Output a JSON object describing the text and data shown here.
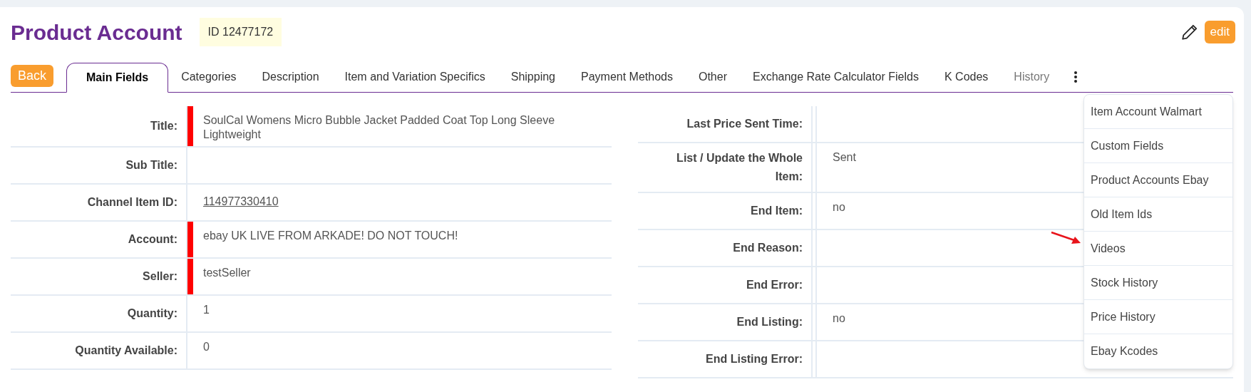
{
  "header": {
    "title": "Product Account",
    "id_badge": "ID 12477172",
    "edit_button": "edit"
  },
  "back_button": "Back",
  "tabs": [
    {
      "label": "Main Fields",
      "selected": true,
      "disabled": false
    },
    {
      "label": "Categories",
      "selected": false,
      "disabled": false
    },
    {
      "label": "Description",
      "selected": false,
      "disabled": false
    },
    {
      "label": "Item and Variation Specifics",
      "selected": false,
      "disabled": false
    },
    {
      "label": "Shipping",
      "selected": false,
      "disabled": false
    },
    {
      "label": "Payment Methods",
      "selected": false,
      "disabled": false
    },
    {
      "label": "Other",
      "selected": false,
      "disabled": false
    },
    {
      "label": "Exchange Rate Calculator Fields",
      "selected": false,
      "disabled": false
    },
    {
      "label": "K Codes",
      "selected": false,
      "disabled": false
    },
    {
      "label": "History",
      "selected": false,
      "disabled": true
    }
  ],
  "left_fields": [
    {
      "label": "Title:",
      "value": "SoulCal Womens Micro Bubble Jacket Padded Coat Top Long Sleeve Lightweight",
      "required": true
    },
    {
      "label": "Sub Title:",
      "required": false
    },
    {
      "label": "Channel Item ID:",
      "value": "114977330410",
      "required": false,
      "link": true
    },
    {
      "label": "Account:",
      "value": "ebay UK LIVE FROM ARKADE! DO NOT TOUCH!",
      "required": true
    },
    {
      "label": "Seller:",
      "value": "testSeller",
      "required": true
    },
    {
      "label": "Quantity:",
      "value": "1",
      "required": false
    },
    {
      "label": "Quantity Available:",
      "value": "0",
      "required": false
    }
  ],
  "right_fields": [
    {
      "label": "Last Price Sent Time:",
      "required": false
    },
    {
      "label": "List / Update the Whole Item:",
      "value": "Sent",
      "required": false
    },
    {
      "label": "End Item:",
      "value": "no",
      "required": false
    },
    {
      "label": "End Reason:",
      "required": false
    },
    {
      "label": "End Error:",
      "required": false
    },
    {
      "label": "End Listing:",
      "value": "no",
      "required": false
    },
    {
      "label": "End Listing Error:",
      "required": false
    }
  ],
  "more_menu": {
    "items": [
      "Item Account Walmart",
      "Custom Fields",
      "Product Accounts Ebay",
      "Old Item Ids",
      "Videos",
      "Stock History",
      "Price History",
      "Ebay Kcodes"
    ]
  }
}
